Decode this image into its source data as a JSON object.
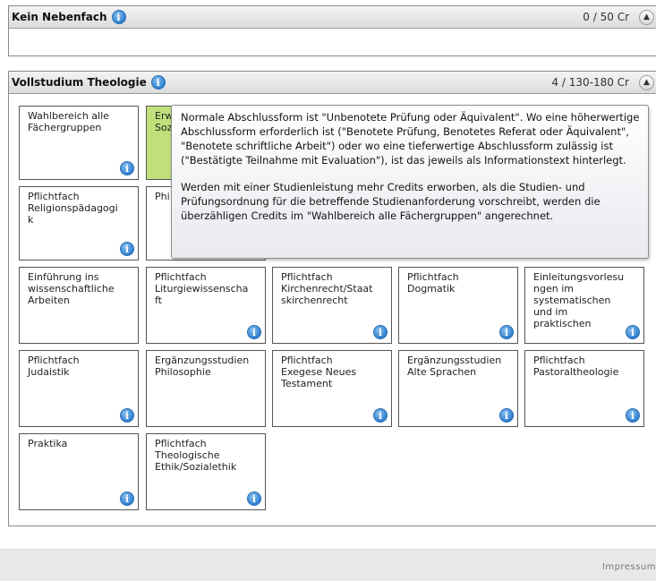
{
  "panel_nebenfach": {
    "title": "Kein Nebenfach",
    "credits": "0 / 50 Cr",
    "info_glyph": "i",
    "collapse_icon": "chevron-up-icon"
  },
  "panel_theologie": {
    "title": "Vollstudium Theologie",
    "credits": "4 / 130-180 Cr",
    "info_glyph": "i",
    "collapse_icon": "chevron-up-icon",
    "tiles": [
      "Wahlbereich alle\nFächergruppen",
      "Erw\nSoz",
      "Pflichtfach\nReligionspädagogi\nk",
      "Phi",
      "Einführung ins\nwissenschaftliche\nArbeiten",
      "Pflichtfach\nLiturgiewissenscha\nft",
      "Pflichtfach\nKirchenrecht/Staat\nskirchenrecht",
      "Pflichtfach\nDogmatik",
      "Einleitungsvorlesu\nngen im\nsystematischen\nund im\npraktischen",
      "Pflichtfach\nJudaistik",
      "Ergänzungsstudien\n Philosophie",
      "Pflichtfach\nExegese Neues\nTestament",
      "Ergänzungsstudien\n Alte Sprachen",
      "Pflichtfach\nPastoraltheologie",
      "Praktika",
      "Pflichtfach\nTheologische\nEthik/Sozialethik"
    ]
  },
  "tooltip": {
    "paragraph1": "Normale Abschlussform ist \"Unbenotete Prüfung oder Äquivalent\". Wo eine höherwertige Abschlussform erforderlich ist (\"Benotete Prüfung, Benotetes Referat oder Äquivalent\", \"Benotete schriftliche Arbeit\") oder wo eine tieferwertige Abschlussform zulässig ist (\"Bestätigte Teilnahme mit Evaluation\"), ist das jeweils als Informationstext hinterlegt.",
    "paragraph2": "Werden mit einer Studienleistung mehr Credits erworben, als die Studien- und Prüfungsordnung für die betreffende Studienanforderung vorschreibt, werden die überzähligen Credits im \"Wahlbereich alle Fächergruppen\" angerechnet."
  },
  "footer": {
    "link": "Impressum"
  },
  "colors": {
    "selected_tile": "#bfe07b",
    "info_icon": "#2f7fcf"
  }
}
